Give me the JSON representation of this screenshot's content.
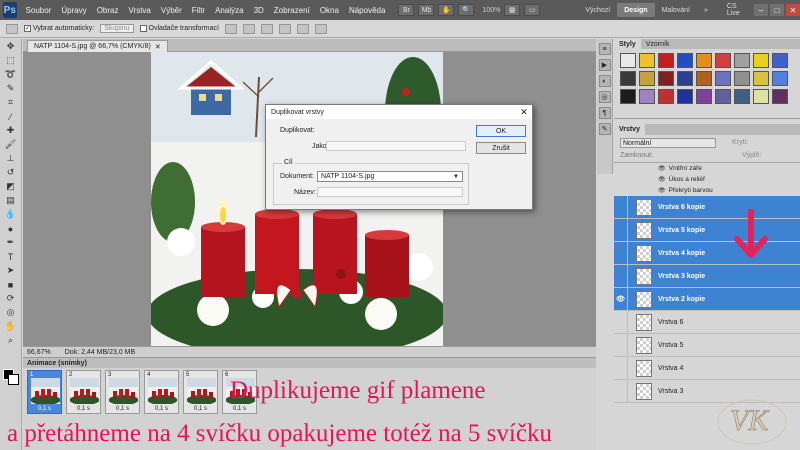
{
  "menubar": {
    "logo": "Ps",
    "items": [
      "Soubor",
      "Úpravy",
      "Obraz",
      "Vrstva",
      "Výběr",
      "Filtr",
      "Analýza",
      "3D",
      "Zobrazení",
      "Okna",
      "Nápověda"
    ],
    "zoom": "100%",
    "workspaces": [
      "Výchozí",
      "Design",
      "Malování"
    ],
    "active_workspace": "Design",
    "cs_live": "CS Live"
  },
  "optbar": {
    "auto_select_label": "Vybrat automaticky:",
    "auto_select_value": "Skupinu",
    "transform_label": "Ovladače transformací"
  },
  "document": {
    "tab_title": "NATP 1104-S.jpg @ 66,7% (CMYK/8)",
    "zoom": "66,67%",
    "doc_size": "Dok: 2,44 MB/23,0 MB"
  },
  "dialog": {
    "title": "Duplikovat vrstvy",
    "duplicate_label": "Duplikovat:",
    "as_label": "Jako:",
    "target_group": "Cíl",
    "document_label": "Dokument:",
    "document_value": "NATP 1104-S.jpg",
    "name_label": "Název:",
    "ok": "OK",
    "cancel": "Zrušit"
  },
  "styles_panel": {
    "tabs": [
      "Styly",
      "Vzorník"
    ],
    "swatches": [
      "#e8e8e8",
      "#f0c030",
      "#c02020",
      "#2050c0",
      "#e09020",
      "#d04040",
      "#a0a0a0",
      "#e8d020",
      "#4060d0",
      "#3a3a3a",
      "#c8a040",
      "#802020",
      "#2a4090",
      "#b06020",
      "#7070c0",
      "#909090",
      "#d8c040",
      "#5080e0",
      "#1c1c1c",
      "#a080c0",
      "#c03030",
      "#2030a0",
      "#8040a0",
      "#6060a0",
      "#406080",
      "#e0e0a0",
      "#603060"
    ]
  },
  "layers_panel": {
    "tab": "Vrstvy",
    "blend_mode": "Normální",
    "opacity_label": "Krytí:",
    "fill_label": "Výplň:",
    "lock_label": "Zamknout:",
    "fx_items": [
      "Vnitřní záře",
      "Úkos a reliéf",
      "Překrytí barvou"
    ],
    "layers": [
      {
        "name": "Vrstva 6 kopie",
        "selected": true
      },
      {
        "name": "Vrstva 5 kopie",
        "selected": true
      },
      {
        "name": "Vrstva 4 kopie",
        "selected": true
      },
      {
        "name": "Vrstva 3 kopie",
        "selected": true
      },
      {
        "name": "Vrstva 2 kopie",
        "selected": true
      },
      {
        "name": "Vrstva 6",
        "selected": false
      },
      {
        "name": "Vrstva 5",
        "selected": false
      },
      {
        "name": "Vrstva 4",
        "selected": false
      },
      {
        "name": "Vrstva 3",
        "selected": false
      }
    ]
  },
  "animation_panel": {
    "title": "Animace (snímky)",
    "frames": [
      {
        "num": "1",
        "delay": "0,1 s"
      },
      {
        "num": "2",
        "delay": "0,1 s"
      },
      {
        "num": "3",
        "delay": "0,1 s"
      },
      {
        "num": "4",
        "delay": "0,1 s"
      },
      {
        "num": "5",
        "delay": "0,1 s"
      },
      {
        "num": "6",
        "delay": "0,1 s"
      }
    ]
  },
  "captions": {
    "line1": "Duplikujeme gif plamene",
    "line2": "a přetáhneme na 4 svíčku opakujeme totéž na 5 svíčku"
  },
  "watermark_letters": "VK",
  "colors": {
    "caption": "#e5135a",
    "selection": "#3e83d2",
    "arrow": "#e0245e"
  }
}
